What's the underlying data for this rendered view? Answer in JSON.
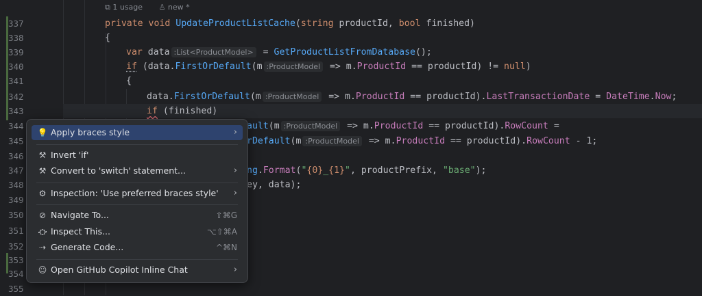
{
  "codelens": {
    "usages": "1 usage",
    "author": "new *"
  },
  "line_numbers": [
    "337",
    "338",
    "339",
    "340",
    "341",
    "342",
    "343",
    "344",
    "345",
    "346",
    "347",
    "348",
    "349",
    "350",
    "351",
    "352",
    "353",
    "354",
    "355"
  ],
  "code": {
    "l337_kw1": "private",
    "l337_kw2": "void",
    "l337_fn": "UpdateProductListCache",
    "l337_open": "(",
    "l337_t1": "string",
    "l337_p1": " productId, ",
    "l337_t2": "bool",
    "l337_p2": " finished)",
    "l338": "{",
    "l339_kw": "var",
    "l339_name": " data",
    "l339_hint": ":List<ProductModel>",
    "l339_eq": " = ",
    "l339_fn": "GetProductListFromDatabase",
    "l339_end": "();",
    "l340_kw": "if",
    "l340_a": " (data.",
    "l340_fn": "FirstOrDefault",
    "l340_b": "(m",
    "l340_hint": ":ProductModel",
    "l340_c": " => m.",
    "l340_prop": "ProductId",
    "l340_d": " == productId) != ",
    "l340_null": "null",
    "l340_e": ")",
    "l341": "{",
    "l342_a": "data.",
    "l342_fn": "FirstOrDefault",
    "l342_b": "(m",
    "l342_hint": ":ProductModel",
    "l342_c": " => m.",
    "l342_prop1": "ProductId",
    "l342_d": " == productId).",
    "l342_prop2": "LastTransactionDate",
    "l342_e": " = ",
    "l342_type": "DateTime",
    "l342_f": ".",
    "l342_prop3": "Now",
    "l342_g": ";",
    "l343_kw": "if",
    "l343_a": " (finished)",
    "l344_fn": "ault",
    "l344_b": "(m",
    "l344_hint": ":ProductModel",
    "l344_c": " => m.",
    "l344_prop1": "ProductId",
    "l344_d": " == productId).",
    "l344_prop2": "RowCount",
    "l344_e": " =",
    "l345_fn": "rDefault",
    "l345_b": "(m",
    "l345_hint": ":ProductModel",
    "l345_c": " => m.",
    "l345_prop1": "ProductId",
    "l345_d": " == productId).",
    "l345_prop2": "RowCount",
    "l345_e": " - 1;",
    "l347_fn": "ng",
    "l347_a": ".",
    "l347_fn2": "Format",
    "l347_b": "(",
    "l347_s1": "\"",
    "l347_esc1": "{0}",
    "l347_s2": "_",
    "l347_esc2": "{1}",
    "l347_s3": "\"",
    "l347_c": ", productPrefix, ",
    "l347_s4": "\"base\"",
    "l347_d": ");",
    "l348": "ey, data);"
  },
  "menu": {
    "items": [
      {
        "label": "Apply braces style",
        "icon": "lightbulb-icon"
      },
      {
        "label": "Invert 'if'",
        "icon": "hammer-icon"
      },
      {
        "label": "Convert to 'switch' statement...",
        "icon": "hammer-icon"
      },
      {
        "label": "Inspection: 'Use preferred braces style'",
        "icon": "gear-icon"
      },
      {
        "label": "Navigate To...",
        "icon": "navigate-icon",
        "shortcut": "⇧⌘G"
      },
      {
        "label": "Inspect This...",
        "icon": "inspect-icon",
        "shortcut": "⌥⇧⌘A"
      },
      {
        "label": "Generate Code...",
        "icon": "generate-icon",
        "shortcut": "^⌘N"
      },
      {
        "label": "Open GitHub Copilot Inline Chat",
        "icon": "copilot-icon"
      }
    ],
    "arrow": "›"
  },
  "colors": {
    "background": "#1f2023",
    "menu_background": "#2b2d30",
    "selection": "#2e436e",
    "keyword": "#cf8e6d",
    "function": "#56a8f5",
    "property": "#c77dbb",
    "string": "#6aab73"
  }
}
